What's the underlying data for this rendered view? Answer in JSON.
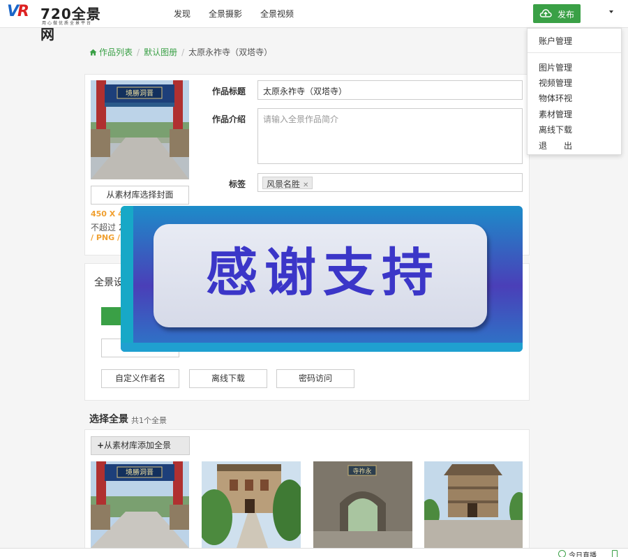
{
  "header": {
    "logo_text": "720全景网",
    "logo_slogan": "用心做优质全景平台",
    "nav": [
      "发现",
      "全景摄影",
      "全景视频"
    ],
    "publish_label": "发布"
  },
  "user_menu": {
    "items": [
      "账户管理",
      "图片管理",
      "视频管理",
      "物体环视",
      "素材管理",
      "离线下载",
      "退　　出"
    ]
  },
  "breadcrumb": {
    "home": "作品列表",
    "album": "默认图册",
    "current": "太原永祚寺（双塔寺）"
  },
  "cover": {
    "choose_label": "从素材库选择封面",
    "size_note": "450 X 45",
    "limit_note": "不超过 2",
    "format_note": "/ PNG /"
  },
  "form": {
    "title_label": "作品标题",
    "title_value": "太原永祚寺（双塔寺）",
    "intro_label": "作品介绍",
    "intro_placeholder": "请输入全景作品简介",
    "tags_label": "标签",
    "tags": [
      "风景名胜"
    ]
  },
  "settings": {
    "title": "全景设",
    "buttons_row2": [
      "自定义作者名",
      "离线下载",
      "密码访问"
    ]
  },
  "overlay": {
    "text": "感谢支持"
  },
  "panoramas": {
    "title": "选择全景",
    "count_label": "共1个全景",
    "add_label": "从素材库添加全景"
  },
  "footer": {
    "live_label": "今日直播"
  },
  "colors": {
    "accent_green": "#3aa046",
    "note_orange": "#f0a030",
    "banner_text": "#3b36c8"
  }
}
